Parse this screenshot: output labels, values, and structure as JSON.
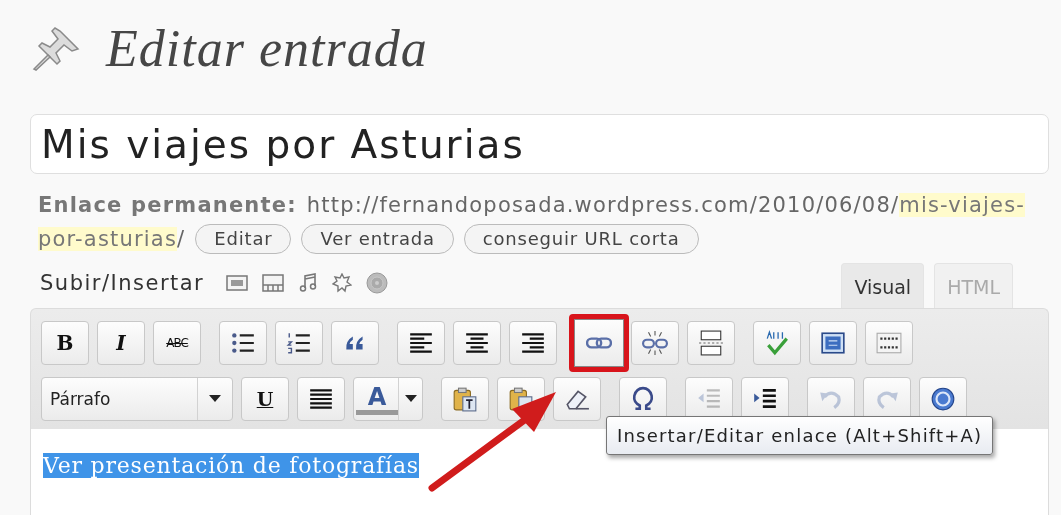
{
  "page": {
    "title": "Editar entrada"
  },
  "post_title": {
    "value": "Mis viajes por Asturias"
  },
  "permalink": {
    "label": "Enlace permanente:",
    "url_prefix": "http://fernandoposada.wordpress.com/2010/06/08/",
    "slug_line_1": "mis-viajes-",
    "slug_line_2": "por-asturias",
    "url_suffix": "/",
    "buttons": [
      "Editar",
      "Ver entrada",
      "conseguir URL corta"
    ]
  },
  "media": {
    "label": "Subir/Insertar"
  },
  "editor_tabs": [
    {
      "label": "Visual",
      "selected": true
    },
    {
      "label": "HTML",
      "selected": false
    }
  ],
  "toolbar": {
    "rows": [
      [
        [
          {
            "kind": "bold",
            "label": "B",
            "highlighted": false,
            "disabled": false
          },
          {
            "kind": "italic",
            "label": "I",
            "highlighted": false,
            "disabled": false
          },
          {
            "kind": "strike",
            "label": "ABC",
            "highlighted": false,
            "disabled": false
          }
        ],
        [
          {
            "kind": "icon",
            "highlighted": false,
            "disabled": false
          },
          {
            "kind": "icon",
            "highlighted": false,
            "disabled": false
          },
          {
            "kind": "icon",
            "highlighted": false,
            "disabled": false
          }
        ],
        [
          {
            "kind": "icon",
            "highlighted": false,
            "disabled": false
          },
          {
            "kind": "icon",
            "highlighted": false,
            "disabled": false
          },
          {
            "kind": "icon",
            "highlighted": false,
            "disabled": false
          }
        ],
        [
          {
            "kind": "icon",
            "highlighted": true,
            "disabled": false
          },
          {
            "kind": "icon",
            "highlighted": false,
            "disabled": false
          },
          {
            "kind": "icon",
            "highlighted": false,
            "disabled": false
          }
        ],
        [
          {
            "kind": "icon",
            "highlighted": false,
            "disabled": false
          },
          {
            "kind": "icon",
            "highlighted": false,
            "disabled": false
          },
          {
            "kind": "icon",
            "highlighted": false,
            "disabled": false
          }
        ]
      ],
      [
        [
          {
            "kind": "select",
            "label": "Párrafo",
            "highlighted": false,
            "disabled": false
          },
          {
            "kind": "underline",
            "label": "U",
            "highlighted": false,
            "disabled": false
          },
          {
            "kind": "icon",
            "highlighted": false,
            "disabled": false
          },
          {
            "kind": "color",
            "label": "A",
            "highlighted": false,
            "disabled": false
          }
        ],
        [
          {
            "kind": "icon",
            "highlighted": false,
            "disabled": false
          },
          {
            "kind": "icon",
            "highlighted": false,
            "disabled": false
          },
          {
            "kind": "icon",
            "highlighted": false,
            "disabled": false
          }
        ],
        [
          {
            "kind": "icon",
            "highlighted": false,
            "disabled": false
          }
        ],
        [
          {
            "kind": "icon",
            "highlighted": false,
            "disabled": true
          },
          {
            "kind": "icon",
            "highlighted": false,
            "disabled": false
          }
        ],
        [
          {
            "kind": "icon",
            "highlighted": false,
            "disabled": true
          },
          {
            "kind": "icon",
            "highlighted": false,
            "disabled": true
          },
          {
            "kind": "icon",
            "highlighted": false,
            "disabled": false
          }
        ]
      ]
    ]
  },
  "content": {
    "text": "Ver presentación de fotografías",
    "selected": true
  },
  "tooltip": {
    "text": "Insertar/Editar enlace (Alt+Shift+A)"
  }
}
